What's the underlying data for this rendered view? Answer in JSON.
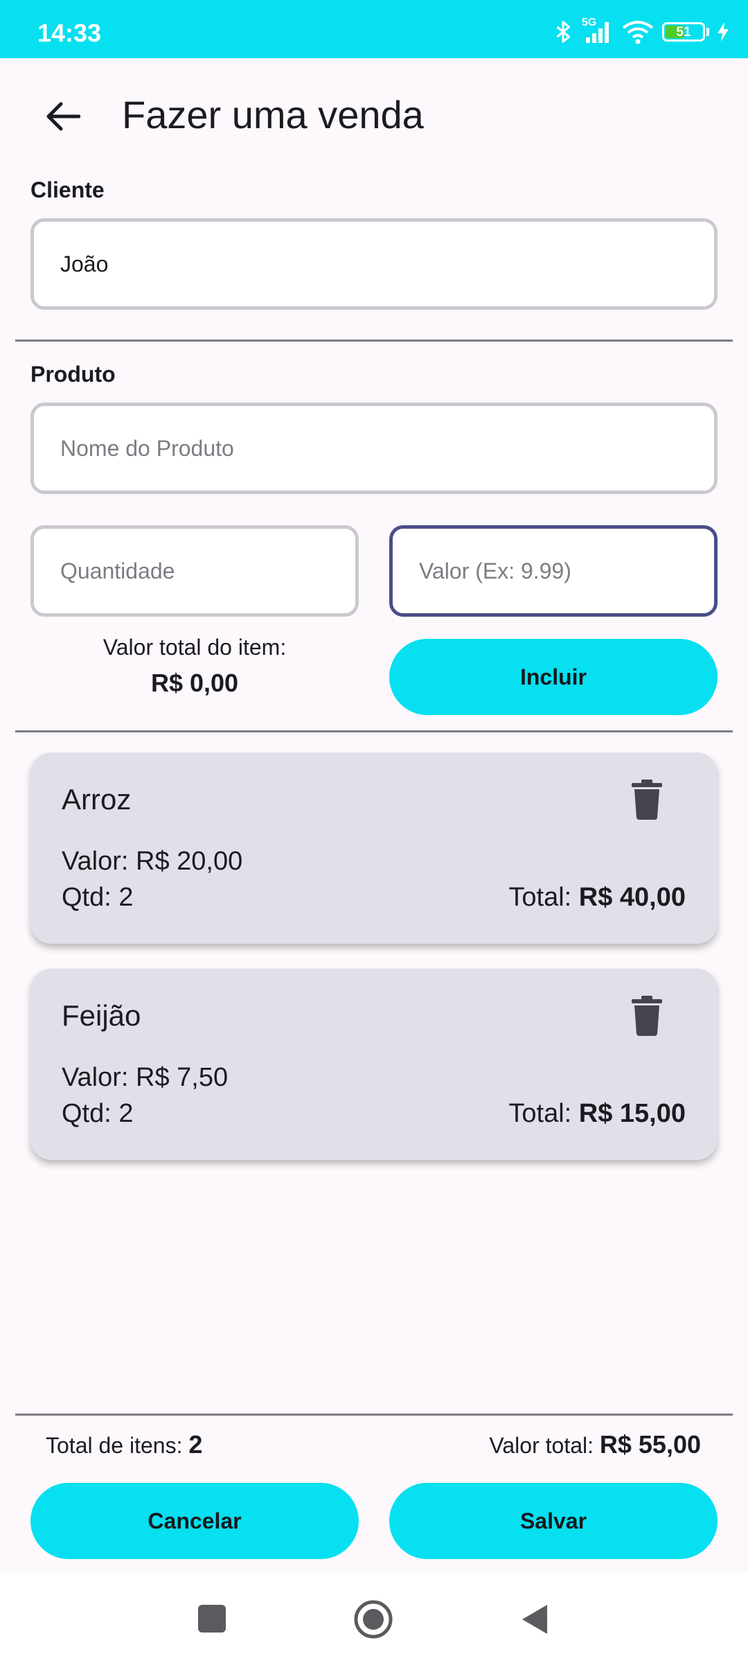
{
  "status_bar": {
    "time": "14:33",
    "network": "5G",
    "battery": "51",
    "battery_level": 0.51,
    "bg_color": "#06e0f0"
  },
  "header": {
    "title": "Fazer uma venda",
    "back_icon": "arrow-back-icon"
  },
  "cliente": {
    "label": "Cliente",
    "value": "João"
  },
  "produto": {
    "label": "Produto",
    "name_placeholder": "Nome do Produto",
    "name_value": "",
    "quantity_placeholder": "Quantidade",
    "quantity_value": "",
    "price_placeholder": "Valor (Ex: 9.99)",
    "price_value": "",
    "item_total_label": "Valor total do item:",
    "item_total_value": "R$ 0,00",
    "include_button": "Incluir"
  },
  "items": [
    {
      "name": "Arroz",
      "price_label": "Valor:",
      "price": "R$ 20,00",
      "qty_label": "Qtd:",
      "qty": "2",
      "total_label": "Total:",
      "total": "R$ 40,00"
    },
    {
      "name": "Feijão",
      "price_label": "Valor:",
      "price": "R$ 7,50",
      "qty_label": "Qtd:",
      "qty": "2",
      "total_label": "Total:",
      "total": "R$ 15,00"
    }
  ],
  "footer": {
    "items_count_label": "Total de itens:",
    "items_count": "2",
    "total_label": "Valor total:",
    "total_value": "R$ 55,00",
    "cancel_button": "Cancelar",
    "save_button": "Salvar"
  },
  "colors": {
    "accent": "#06e0f0",
    "card_bg": "#e1e0e9",
    "focus_border": "#4a4e86",
    "background": "#fcf8fc"
  }
}
